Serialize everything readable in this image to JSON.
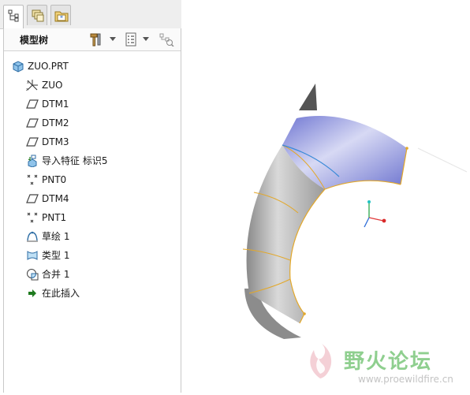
{
  "tabs": [
    {
      "name": "model-tree",
      "icon": "model-tree-icon"
    },
    {
      "name": "layers",
      "icon": "layers-icon"
    },
    {
      "name": "favorites",
      "icon": "folder-star-icon"
    }
  ],
  "panel": {
    "title": "模型树",
    "tools": [
      "settings-hammer-icon",
      "show-list-icon",
      "tree-filter-icon"
    ]
  },
  "tree": {
    "items": [
      {
        "label": "ZUO.PRT",
        "icon": "part-icon"
      },
      {
        "label": "ZUO",
        "icon": "coordinate-system-icon"
      },
      {
        "label": "DTM1",
        "icon": "datum-plane-icon"
      },
      {
        "label": "DTM2",
        "icon": "datum-plane-icon"
      },
      {
        "label": "DTM3",
        "icon": "datum-plane-icon"
      },
      {
        "label": "导入特征 标识5",
        "icon": "import-feature-icon"
      },
      {
        "label": "PNT0",
        "icon": "datum-point-icon"
      },
      {
        "label": "DTM4",
        "icon": "datum-plane-icon"
      },
      {
        "label": "PNT1",
        "icon": "datum-point-icon"
      },
      {
        "label": "草绘 1",
        "icon": "sketch-icon"
      },
      {
        "label": "类型 1",
        "icon": "boundary-blend-icon"
      },
      {
        "label": "合并 1",
        "icon": "merge-icon"
      },
      {
        "label": "在此插入",
        "icon": "insert-here-arrow-icon"
      }
    ]
  },
  "watermark": {
    "title": "野火论坛",
    "url": "www.proewildfire.cn"
  },
  "colors": {
    "surface_blue": "#7f86d8",
    "surface_gray": "#a9a9a9",
    "edge_yellow": "#e3a82a",
    "insert_green": "#1e7a1e",
    "watermark_green": "#8fcf8f"
  }
}
